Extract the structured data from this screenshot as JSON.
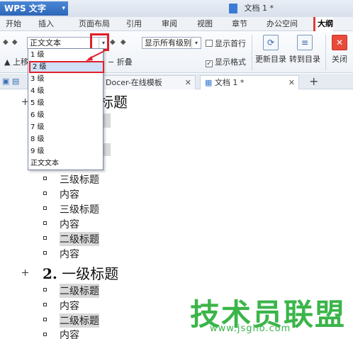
{
  "app": {
    "name": "WPS 文字",
    "dropdown_arrow": "▾"
  },
  "window": {
    "doc_title": "文档 1 *"
  },
  "ribbon": {
    "tabs": [
      "开始",
      "插入",
      "页面布局",
      "引用",
      "审阅",
      "视图",
      "章节",
      "办公空间",
      "大纲"
    ],
    "active_tab": "大纲"
  },
  "toolbar": {
    "nav_arrows_left": "◆ ◆",
    "nav_arrows_right": "◆ ◆",
    "level_combo_value": "正文文本",
    "show_levels_value": "显示所有级别",
    "promote_label": "上移",
    "fold_label": "折叠",
    "show_first_line": "显示首行",
    "show_format": "显示格式",
    "show_format_checked": true,
    "update_toc": "更新目录",
    "goto_toc": "转到目录",
    "close": "关闭"
  },
  "doc_tabs": [
    {
      "label": "Docer-在线模板",
      "close": "✕"
    },
    {
      "label": "文档 1 *",
      "close": "✕"
    }
  ],
  "doc_tab_add": "+",
  "level_dropdown": {
    "items": [
      "1 级",
      "2 级",
      "3 级",
      "4 级",
      "5 级",
      "6 级",
      "7 级",
      "8 级",
      "9 级",
      "正文文本"
    ],
    "selected_index": 1
  },
  "document": {
    "heading1_partial": "标题",
    "lines": [
      {
        "text": "三级标题",
        "highlight": false
      },
      {
        "text": "内容",
        "highlight": false
      },
      {
        "text": "三级标题",
        "highlight": false
      },
      {
        "text": "内容",
        "highlight": false
      },
      {
        "text": "二级标题",
        "highlight": true
      },
      {
        "text": "内容",
        "highlight": false
      }
    ],
    "heading2_num": "2.",
    "heading2_text": "一级标题",
    "lines2": [
      {
        "text": "二级标题",
        "highlight": true
      },
      {
        "text": "内容",
        "highlight": false
      },
      {
        "text": "二级标题",
        "highlight": true
      },
      {
        "text": "内容",
        "highlight": false
      }
    ]
  },
  "watermark": {
    "brand": "技术员联盟",
    "url": "www.jsgho.com",
    "color": "#3bb54a"
  }
}
